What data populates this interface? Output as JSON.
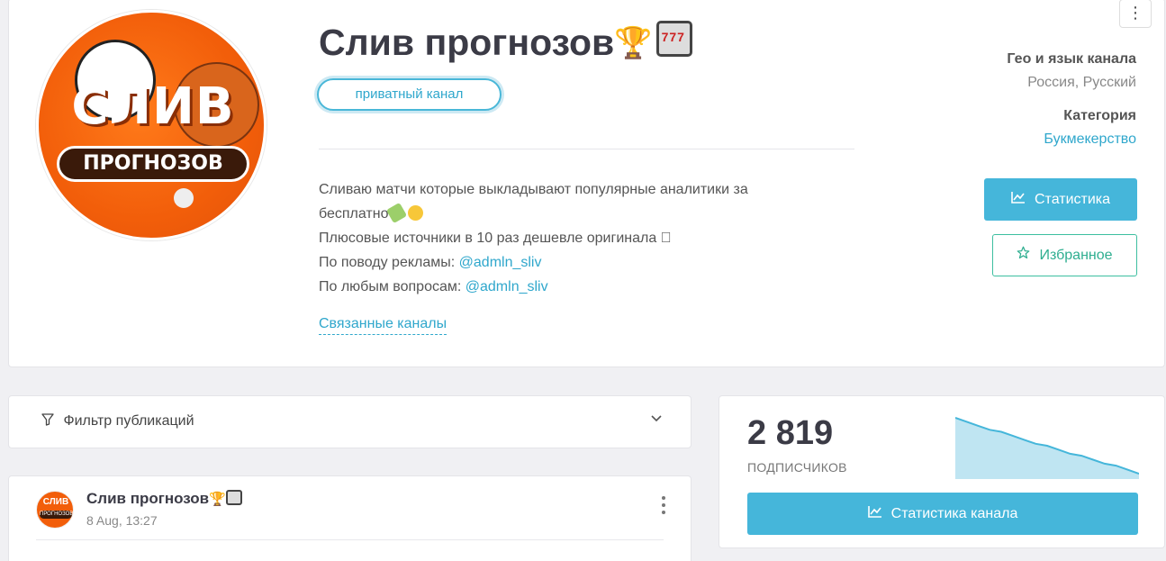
{
  "header": {
    "title": "Слив прогнозов",
    "title_emojis": [
      "trophy-icon",
      "slot-machine-icon"
    ],
    "badge": "приватный канал",
    "avatar_text_top": "СЛИВ",
    "avatar_text_bottom": "ПРОГНОЗОВ",
    "description": {
      "line1": "Сливаю матчи которые выкладывают популярные аналитики за",
      "line2": "бесплатно",
      "line3": "Плюсовые источники в 10 раз дешевле оригинала ⃞",
      "line4_prefix": "По поводу рекламы: ",
      "line4_link": "@admln_sliv",
      "line5_prefix": "По любым вопросам: ",
      "line5_link": "@admln_sliv"
    },
    "related_channels": "Связанные каналы",
    "menu_icon": "kebab-menu-icon"
  },
  "meta": {
    "geo_label": "Гео и язык канала",
    "geo_value": "Россия, Русский",
    "category_label": "Категория",
    "category_value": "Букмекерство"
  },
  "actions": {
    "stats": "Статистика",
    "favorite": "Избранное"
  },
  "filter": {
    "label": "Фильтр публикаций"
  },
  "post": {
    "author": "Слив прогнозов",
    "date": "8 Aug, 13:27",
    "avatar_text_top": "СЛИВ",
    "avatar_text_bottom": "ПРОГНОЗОВ"
  },
  "subscribers": {
    "count": "2 819",
    "label": "ПОДПИСЧИКОВ",
    "button": "Статистика канала"
  },
  "chart_data": {
    "type": "area",
    "values": [
      100,
      98,
      96,
      94,
      93,
      91,
      89,
      87,
      86,
      84,
      82,
      81,
      79,
      77,
      76,
      74,
      72
    ],
    "color": "#45b6da"
  },
  "colors": {
    "accent": "#45b6da",
    "link": "#2fa7cc",
    "favorite": "#2fae90",
    "avatar": "#f25e0a"
  }
}
